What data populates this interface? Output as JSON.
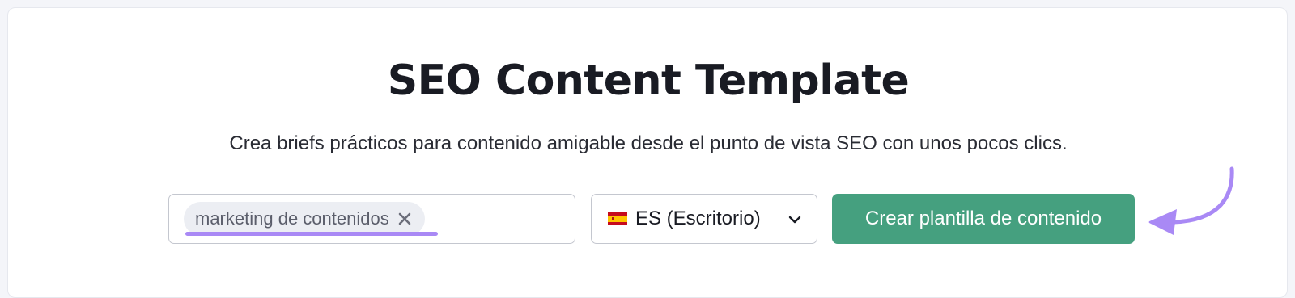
{
  "header": {
    "title": "SEO Content Template",
    "subtitle": "Crea briefs prácticos para contenido amigable desde el punto de vista SEO con unos pocos clics."
  },
  "form": {
    "keyword_chip": "marketing de contenidos",
    "database": {
      "selected": "ES (Escritorio)",
      "flag": "spain-flag"
    },
    "submit_label": "Crear plantilla de contenido"
  },
  "colors": {
    "accent_purple": "#a989f5",
    "button_green": "#45a07f",
    "title_text": "#191b23"
  }
}
